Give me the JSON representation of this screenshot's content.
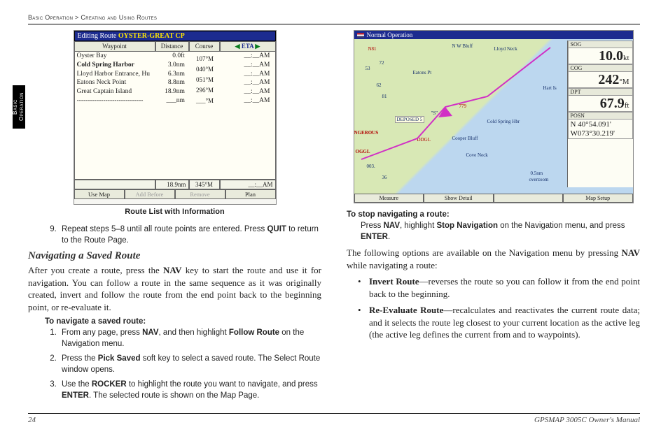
{
  "running_head": {
    "left": "Basic Operation",
    "sep": ">",
    "right": "Creating and Using Routes"
  },
  "side_tab": "Basic Operation",
  "route_list": {
    "title_prefix": "Editing Route",
    "title_route": "OYSTER-GREAT CP",
    "headers": {
      "wp": "Waypoint",
      "dist": "Distance",
      "course": "Course",
      "eta": "ETA"
    },
    "rows": [
      {
        "wp": "Oyster Bay",
        "dist": "0.0ft",
        "eta": "__:__AM"
      },
      {
        "wp": "Cold Spring Harbor",
        "dist": "3.0nm",
        "eta": "__:__AM"
      },
      {
        "wp": "Lloyd Harbor Entrance, Hu",
        "dist": "6.3nm",
        "eta": "__:__AM"
      },
      {
        "wp": "Eatons Neck Point",
        "dist": "8.8nm",
        "eta": "__:__AM"
      },
      {
        "wp": "Great Captain Island",
        "dist": "18.9nm",
        "eta": "__:__AM"
      },
      {
        "wp": "------------------------------",
        "dist": "___nm",
        "eta": "__:__AM"
      }
    ],
    "courses": [
      "107°M",
      "040°M",
      "051°M",
      "296°M",
      "___°M"
    ],
    "totals": {
      "dist": "18.9nm",
      "course": "345°M",
      "eta": "__:__AM"
    },
    "softkeys": {
      "a": "Use Map",
      "b": "Add Before",
      "c": "Remove",
      "d": "Plan"
    },
    "caption": "Route List with Information"
  },
  "left": {
    "step9_a": "Repeat steps 5–8 until all route points are entered. Press ",
    "step9_b": "QUIT",
    "step9_c": " to return to the Route Page.",
    "h_nav_saved": "Navigating a Saved Route",
    "p_nav_saved": "After you create a route, press the NAV key to start the route and use it for navigation. You can follow a route in the same sequence as it was originally created, invert and follow the route from the end point back to the beginning point, or re-evaluate it.",
    "h_to_nav": "To navigate a saved route:",
    "s1_a": "From any page, press ",
    "s1_b": "NAV",
    "s1_c": ", and then highlight ",
    "s1_d": "Follow Route",
    "s1_e": " on the Navigation menu.",
    "s2_a": "Press the ",
    "s2_b": "Pick Saved",
    "s2_c": " soft key to select a saved route. The Select Route window opens.",
    "s3_a": "Use the ",
    "s3_b": "ROCKER",
    "s3_c": " to highlight the route you want to navigate, and press ",
    "s3_d": "ENTER",
    "s3_e": ". The selected route is shown on the Map Page."
  },
  "map": {
    "title": "Normal Operation",
    "sog_lbl": "SOG",
    "sog_val": "10.0",
    "sog_unit": "kt",
    "cog_lbl": "COG",
    "cog_val": "242",
    "cog_unit": "°M",
    "dpt_lbl": "DPT",
    "dpt_val": "67.9",
    "dpt_unit": "ft",
    "posn_lbl": "POSN",
    "posn_lat": "N  40°54.091'",
    "posn_lon": "W073°30.219'",
    "softkeys": {
      "a": "Measure",
      "b": "Show Detail",
      "c": "",
      "d": "Map Setup"
    },
    "labels": [
      "N W Bluff",
      "Lloyd Neck",
      "Eatons Pt",
      "Hart Is",
      "Cold Spring Hbr",
      "Cooper Bluff",
      "Cove Neck",
      "DEPOSED  5",
      "NGEROUS",
      "0.5nm",
      "overzoom",
      "OGGL",
      "N81",
      "72",
      "779",
      "003.",
      "81",
      "53",
      "62",
      "\"S\"",
      "DDGL",
      "36"
    ]
  },
  "right": {
    "h_stop": "To stop navigating a route:",
    "stop_a": "Press ",
    "stop_b": "NAV",
    "stop_c": ", highlight ",
    "stop_d": "Stop Navigation",
    "stop_e": " on the Navigation menu, and press ",
    "stop_f": "ENTER",
    "stop_g": ".",
    "p_options": "The following options are available on the Navigation menu by pressing NAV while navigating a route:",
    "b1_t": "Invert Route",
    "b1_r": "—reverses the route so you can follow it from the end point back to the beginning.",
    "b2_t": "Re-Evaluate Route",
    "b2_r": "—recalculates and reactivates the current route data; and it selects the route leg closest to your current location as the active leg (the active leg defines the current from and to waypoints)."
  },
  "footer": {
    "page": "24",
    "manual": "GPSMAP 3005C Owner's Manual"
  }
}
